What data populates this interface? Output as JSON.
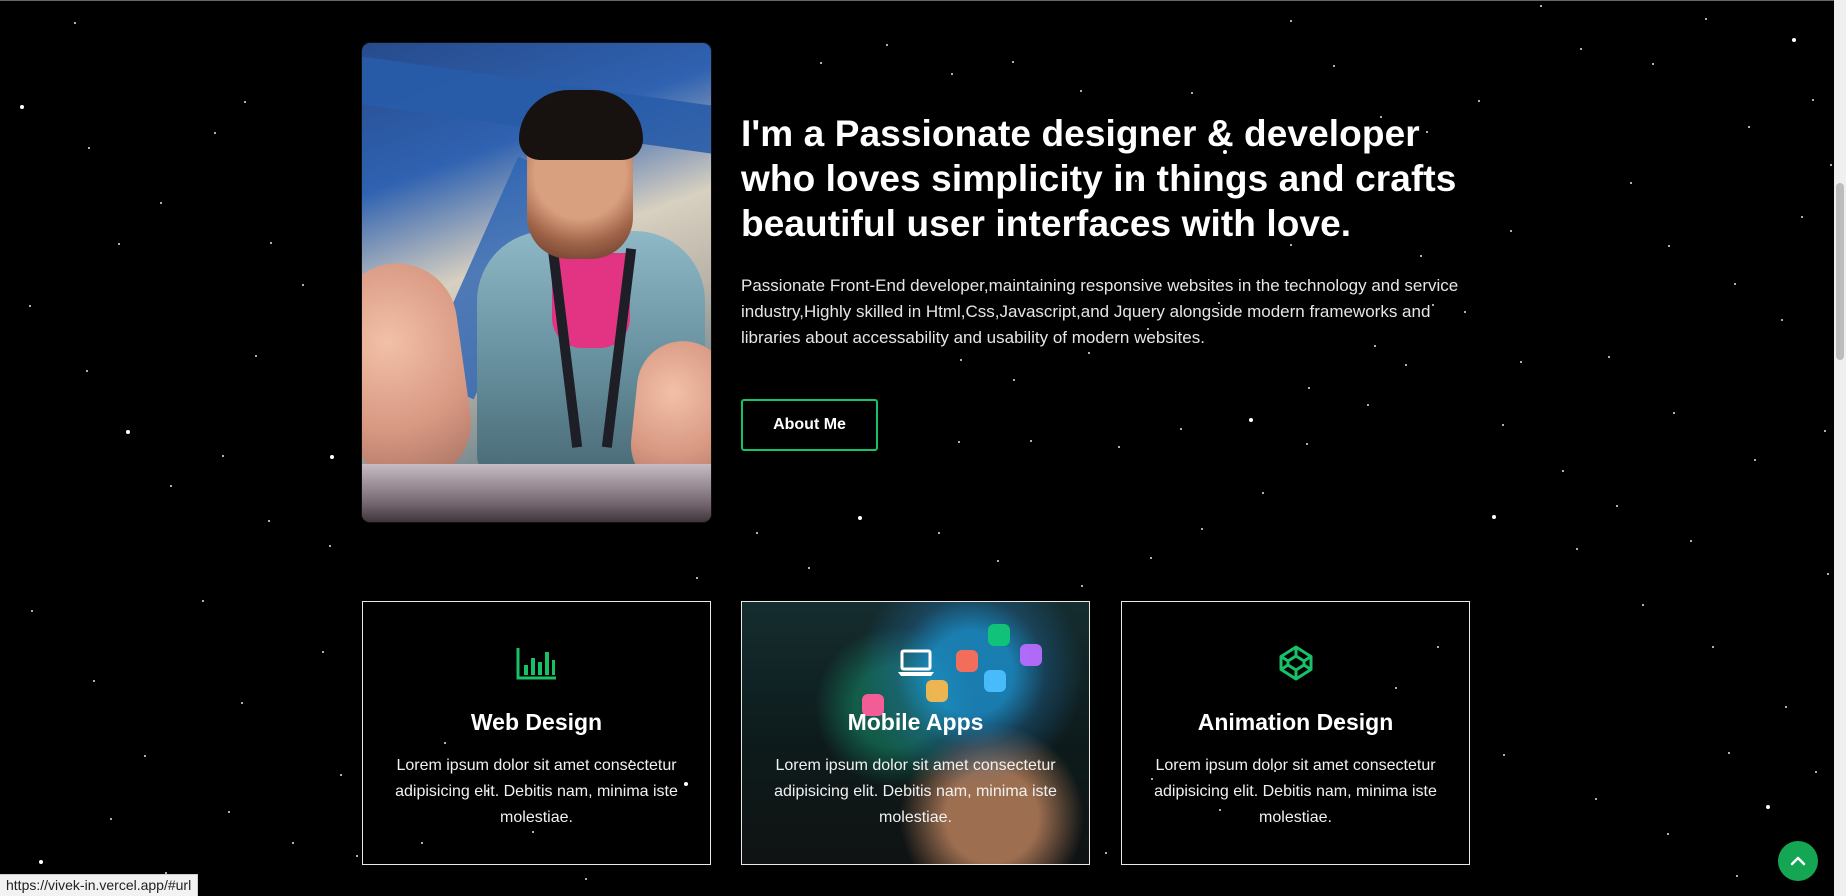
{
  "hero": {
    "heading": "I'm a Passionate designer & developer who loves simplicity in things and crafts beautiful user interfaces with love.",
    "paragraph": "Passionate Front-End developer,maintaining responsive websites in the technology and service industry,Highly skilled in Html,Css,Javascript,and Jquery alongside modern frameworks and libraries about accessability and usability of modern websites.",
    "button_label": "About Me",
    "accent_color": "#17c267"
  },
  "services": [
    {
      "icon": "bar-chart-icon",
      "title": "Web Design",
      "text": "Lorem ipsum dolor sit amet consectetur adipisicing elit. Debitis nam, minima iste molestiae."
    },
    {
      "icon": "laptop-icon",
      "title": "Mobile Apps",
      "text": "Lorem ipsum dolor sit amet consectetur adipisicing elit. Debitis nam, minima iste molestiae."
    },
    {
      "icon": "codepen-icon",
      "title": "Animation Design",
      "text": "Lorem ipsum dolor sit amet consectetur adipisicing elit. Debitis nam, minima iste molestiae."
    }
  ],
  "browser": {
    "status_url": "https://vivek-in.vercel.app/#url",
    "back_to_top_icon": "chevron-up-icon"
  }
}
